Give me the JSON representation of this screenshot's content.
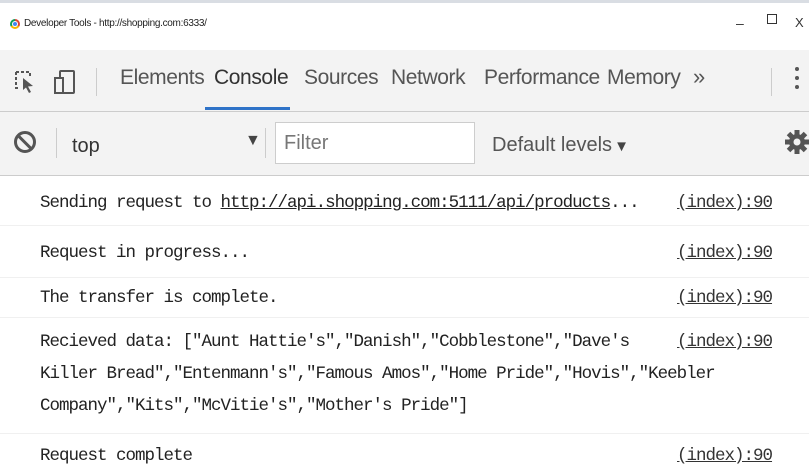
{
  "window": {
    "title": "Developer Tools - http://shopping.com:6333/",
    "minimize": "–",
    "close": "X"
  },
  "toolbar": {
    "tabs": [
      "Elements",
      "Console",
      "Sources",
      "Network",
      "Performance",
      "Memory"
    ],
    "active_tab": "Console",
    "overflow": "»"
  },
  "filterbar": {
    "context": "top",
    "filter_placeholder": "Filter",
    "filter_value": "",
    "levels": "Default levels"
  },
  "messages": [
    {
      "prefix": "Sending request to ",
      "link": "http://api.shopping.com:5111/api/products",
      "suffix": "...",
      "source": "(index):90"
    },
    {
      "text": "Request in progress...",
      "source": "(index):90"
    },
    {
      "text": "The transfer is complete.",
      "source": "(index):90"
    },
    {
      "line1": "Recieved data: [\"Aunt Hattie's\",\"Danish\",\"Cobblestone\",\"Dave's",
      "line2": "Killer Bread\",\"Entenmann's\",\"Famous Amos\",\"Home Pride\",\"Hovis\",\"Keebler",
      "line3": "Company\",\"Kits\",\"McVitie's\",\"Mother's Pride\"]",
      "source": "(index):90"
    },
    {
      "text": "Request complete",
      "source": "(index):90"
    }
  ],
  "colors": {
    "accent": "#2f73c8",
    "toolbar_bg": "#f3f3f3"
  },
  "icons": [
    "chrome-icon",
    "inspect-element-icon",
    "device-toolbar-icon",
    "clear-console-icon",
    "dropdown-caret-icon",
    "gear-icon",
    "kebab-menu-icon"
  ]
}
